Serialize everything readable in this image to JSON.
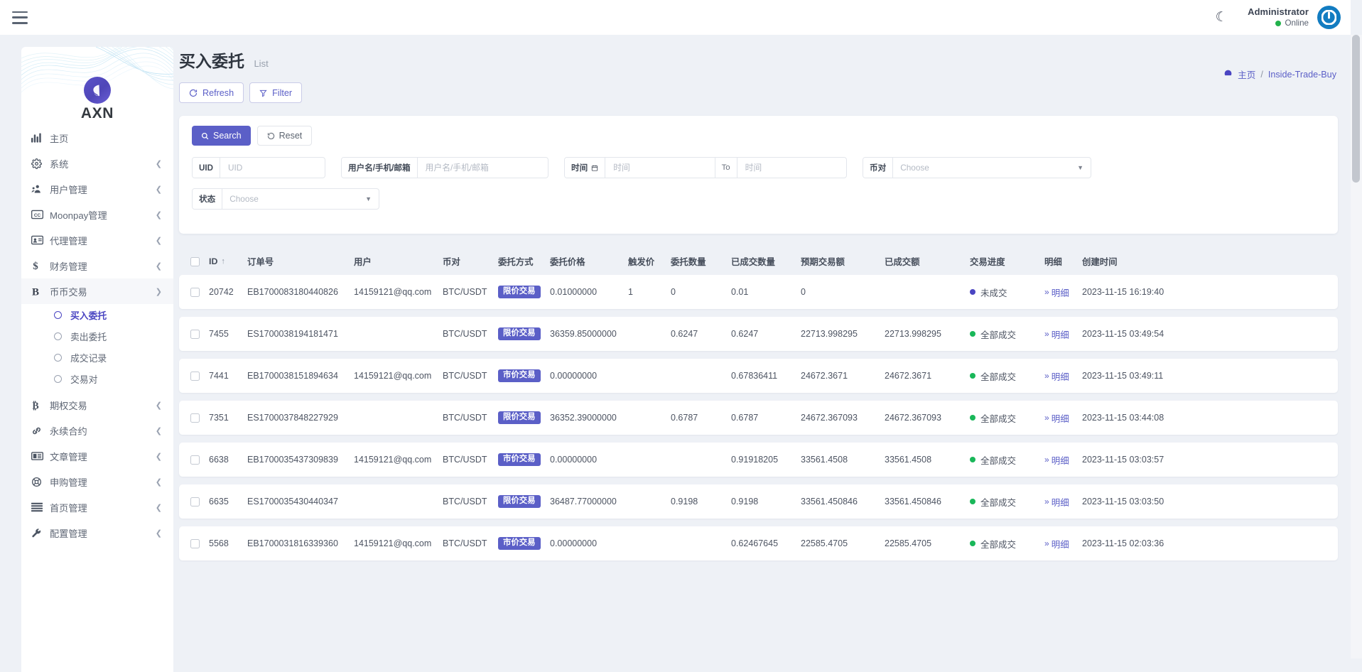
{
  "topbar": {
    "menu_icon": "hamburger-icon",
    "theme_icon": "moon-icon",
    "user_name": "Administrator",
    "user_status": "Online",
    "avatar_icon": "power-icon"
  },
  "sidebar": {
    "brand": "AXN",
    "items": [
      {
        "label": "主页",
        "icon": "chart-bars-icon",
        "expandable": false
      },
      {
        "label": "系统",
        "icon": "gear-icon",
        "expandable": true
      },
      {
        "label": "用户管理",
        "icon": "users-icon",
        "expandable": true
      },
      {
        "label": "Moonpay管理",
        "icon": "cc-icon",
        "expandable": true
      },
      {
        "label": "代理管理",
        "icon": "id-card-icon",
        "expandable": true
      },
      {
        "label": "财务管理",
        "icon": "dollar-icon",
        "expandable": true
      },
      {
        "label": "币币交易",
        "icon": "bold-b-icon",
        "expandable": true,
        "expanded": true
      },
      {
        "label": "期权交易",
        "icon": "bitcoin-icon",
        "expandable": true
      },
      {
        "label": "永续合约",
        "icon": "link-icon",
        "expandable": true
      },
      {
        "label": "文章管理",
        "icon": "newspaper-icon",
        "expandable": true
      },
      {
        "label": "申购管理",
        "icon": "lifebuoy-icon",
        "expandable": true
      },
      {
        "label": "首页管理",
        "icon": "stack-lines-icon",
        "expandable": true
      },
      {
        "label": "配置管理",
        "icon": "wrench-icon",
        "expandable": true
      }
    ],
    "subitems": [
      {
        "label": "买入委托",
        "active": true
      },
      {
        "label": "卖出委托",
        "active": false
      },
      {
        "label": "成交记录",
        "active": false
      },
      {
        "label": "交易对",
        "active": false
      }
    ]
  },
  "page": {
    "title": "买入委托",
    "subtitle": "List",
    "refresh_label": "Refresh",
    "filter_label": "Filter",
    "breadcrumb_home": "主页",
    "breadcrumb_sep": "/",
    "breadcrumb_current": "Inside-Trade-Buy"
  },
  "filter": {
    "search_label": "Search",
    "reset_label": "Reset",
    "uid_label": "UID",
    "uid_placeholder": "UID",
    "uid_value": "",
    "user_label": "用户名/手机/邮箱",
    "user_placeholder": "用户名/手机/邮箱",
    "user_value": "",
    "time_label": "时间",
    "time_icon": "calendar-icon",
    "time_from_placeholder": "时间",
    "time_from_value": "",
    "time_to_label": "To",
    "time_to_placeholder": "时间",
    "time_to_value": "",
    "pair_label": "币对",
    "pair_value": "Choose",
    "state_label": "状态",
    "state_value": "Choose"
  },
  "table": {
    "columns": [
      "ID",
      "订单号",
      "用户",
      "币对",
      "委托方式",
      "委托价格",
      "触发价",
      "委托数量",
      "已成交数量",
      "预期交易额",
      "已成交额",
      "交易进度",
      "明细",
      "创建时间"
    ],
    "detail_label": "明细",
    "rows": [
      {
        "id": "20742",
        "order": "EB1700083180440826",
        "user": "14159121@qq.com",
        "pair": "BTC/USDT",
        "mode": "限价交易",
        "price": "0.01000000",
        "trigger": "1",
        "qty": "0",
        "done_qty": "0.01",
        "expected": "0",
        "amount": "",
        "progress": "未成交",
        "progress_color": "blue",
        "time": "2023-11-15 16:19:40"
      },
      {
        "id": "7455",
        "order": "ES1700038194181471",
        "user": "",
        "pair": "BTC/USDT",
        "mode": "限价交易",
        "price": "36359.85000000",
        "trigger": "",
        "qty": "0.6247",
        "done_qty": "0.6247",
        "expected": "22713.998295",
        "amount": "22713.998295",
        "progress": "全部成交",
        "progress_color": "green",
        "time": "2023-11-15 03:49:54"
      },
      {
        "id": "7441",
        "order": "EB1700038151894634",
        "user": "14159121@qq.com",
        "pair": "BTC/USDT",
        "mode": "市价交易",
        "price": "0.00000000",
        "trigger": "",
        "qty": "",
        "done_qty": "0.67836411",
        "expected": "24672.3671",
        "amount": "24672.3671",
        "progress": "全部成交",
        "progress_color": "green",
        "time": "2023-11-15 03:49:11"
      },
      {
        "id": "7351",
        "order": "ES1700037848227929",
        "user": "",
        "pair": "BTC/USDT",
        "mode": "限价交易",
        "price": "36352.39000000",
        "trigger": "",
        "qty": "0.6787",
        "done_qty": "0.6787",
        "expected": "24672.367093",
        "amount": "24672.367093",
        "progress": "全部成交",
        "progress_color": "green",
        "time": "2023-11-15 03:44:08"
      },
      {
        "id": "6638",
        "order": "EB1700035437309839",
        "user": "14159121@qq.com",
        "pair": "BTC/USDT",
        "mode": "市价交易",
        "price": "0.00000000",
        "trigger": "",
        "qty": "",
        "done_qty": "0.91918205",
        "expected": "33561.4508",
        "amount": "33561.4508",
        "progress": "全部成交",
        "progress_color": "green",
        "time": "2023-11-15 03:03:57"
      },
      {
        "id": "6635",
        "order": "ES1700035430440347",
        "user": "",
        "pair": "BTC/USDT",
        "mode": "限价交易",
        "price": "36487.77000000",
        "trigger": "",
        "qty": "0.9198",
        "done_qty": "0.9198",
        "expected": "33561.450846",
        "amount": "33561.450846",
        "progress": "全部成交",
        "progress_color": "green",
        "time": "2023-11-15 03:03:50"
      },
      {
        "id": "5568",
        "order": "EB1700031816339360",
        "user": "14159121@qq.com",
        "pair": "BTC/USDT",
        "mode": "市价交易",
        "price": "0.00000000",
        "trigger": "",
        "qty": "",
        "done_qty": "0.62467645",
        "expected": "22585.4705",
        "amount": "22585.4705",
        "progress": "全部成交",
        "progress_color": "green",
        "time": "2023-11-15 02:03:36"
      }
    ]
  },
  "colors": {
    "accent": "#5b5fc7",
    "success": "#19b759",
    "pending": "#4a45c2",
    "page_bg": "#eef1f6"
  }
}
